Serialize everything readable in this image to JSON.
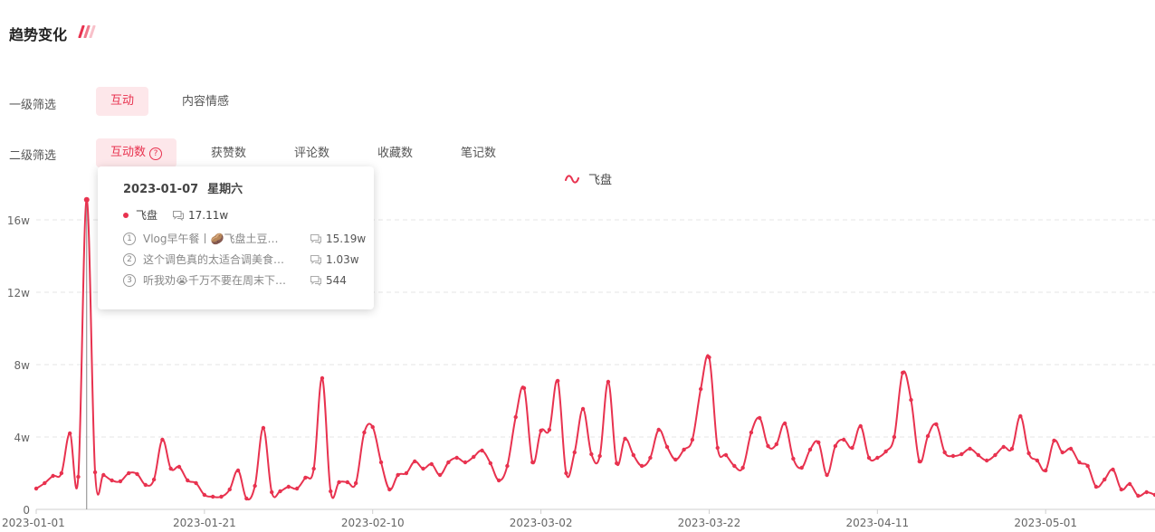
{
  "header": {
    "title": "趋势变化"
  },
  "filters": {
    "level1": {
      "label": "一级筛选",
      "options": [
        "互动",
        "内容情感"
      ],
      "selected": 0
    },
    "level2": {
      "label": "二级筛选",
      "options": [
        "互动数",
        "获赞数",
        "评论数",
        "收藏数",
        "笔记数"
      ],
      "selected": 0
    }
  },
  "colors": {
    "accent": "#e8324f",
    "accent_bg": "#fde7ea",
    "grid": "#e5e5e5"
  },
  "tooltip": {
    "date": "2023-01-07",
    "weekday": "星期六",
    "series": "飞盘",
    "value": "17.11w",
    "notes": [
      {
        "index": "1",
        "title": "Vlog早午餐丨🥔飞盘土豆…",
        "value": "15.19w"
      },
      {
        "index": "2",
        "title": "这个调色真的太适合调美食…",
        "value": "1.03w"
      },
      {
        "index": "3",
        "title": "听我劝😭千万不要在周末下…",
        "value": "544"
      }
    ]
  },
  "chart_data": {
    "type": "line",
    "legend": "飞盘",
    "y_unit": "w",
    "yticks": [
      "0",
      "4w",
      "8w",
      "12w",
      "16w"
    ],
    "ylim": [
      0,
      18
    ],
    "xticks": [
      "2023-01-01",
      "2023-01-21",
      "2023-02-10",
      "2023-03-02",
      "2023-03-22",
      "2023-04-11",
      "2023-05-01"
    ],
    "x_start": "2023-01-01",
    "grid": true,
    "highlight_date": "2023-01-07",
    "series": [
      {
        "name": "飞盘",
        "values": [
          1.15,
          1.45,
          1.85,
          2.0,
          4.2,
          1.8,
          17.11,
          2.05,
          1.9,
          1.6,
          1.55,
          2.0,
          1.95,
          1.35,
          1.65,
          3.85,
          2.25,
          2.35,
          1.6,
          1.45,
          0.8,
          0.7,
          0.7,
          1.1,
          2.15,
          0.6,
          1.3,
          4.5,
          0.95,
          1.0,
          1.25,
          1.15,
          1.75,
          2.25,
          7.25,
          1.0,
          1.5,
          1.5,
          1.45,
          4.25,
          4.55,
          2.6,
          1.1,
          1.9,
          2.0,
          2.65,
          2.25,
          2.5,
          1.9,
          2.6,
          2.85,
          2.6,
          2.9,
          3.25,
          2.55,
          1.6,
          2.4,
          5.1,
          6.7,
          2.6,
          4.35,
          4.4,
          7.1,
          2.0,
          3.15,
          5.55,
          3.05,
          2.95,
          7.05,
          2.55,
          3.9,
          3.0,
          2.4,
          2.85,
          4.4,
          3.45,
          2.75,
          3.3,
          3.85,
          6.65,
          8.4,
          3.4,
          3.0,
          2.4,
          2.3,
          4.25,
          5.05,
          3.5,
          3.6,
          4.75,
          2.8,
          2.3,
          3.3,
          3.7,
          1.9,
          3.5,
          3.85,
          3.4,
          4.6,
          2.85,
          2.85,
          3.2,
          4.0,
          7.55,
          6.05,
          2.65,
          4.05,
          4.7,
          3.15,
          2.95,
          3.05,
          3.35,
          3.0,
          2.7,
          3.0,
          3.45,
          3.35,
          5.15,
          3.1,
          2.7,
          2.15,
          3.8,
          3.15,
          3.35,
          2.6,
          2.4,
          1.25,
          1.65,
          2.2,
          1.1,
          1.4,
          0.75,
          0.95,
          0.8
        ]
      }
    ]
  }
}
